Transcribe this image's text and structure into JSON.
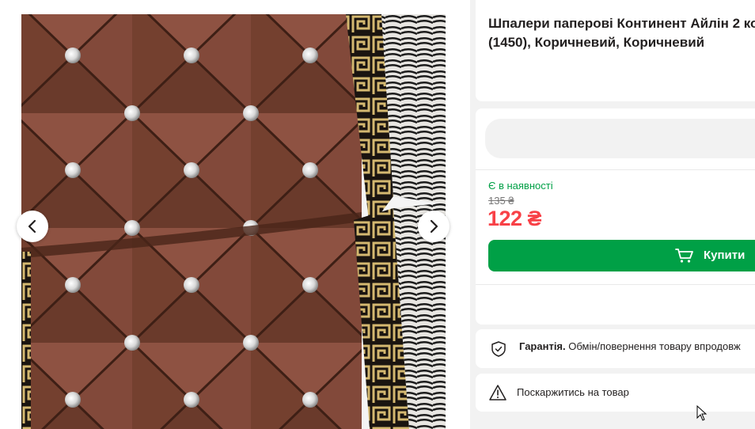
{
  "product": {
    "title_line1": "Шпалери паперові Континент Айлін 2 ко",
    "title_line2": "(1450), Коричневий, Коричневий"
  },
  "gallery": {
    "prev_icon": "chevron-left-icon",
    "next_icon": "chevron-right-icon"
  },
  "purchase": {
    "availability": "Є в наявності",
    "old_price": "135 ₴",
    "price": "122 ₴",
    "buy_label": "Купити",
    "buy_icon": "cart-icon"
  },
  "info": {
    "warranty_label": "Гарантія.",
    "warranty_text": " Обмін/повернення товару впродовж",
    "complain_label": "Поскаржитись на товар"
  },
  "colors": {
    "accent_green": "#00a046",
    "price_red": "#f84147",
    "background_gray": "#f2f2f2"
  }
}
